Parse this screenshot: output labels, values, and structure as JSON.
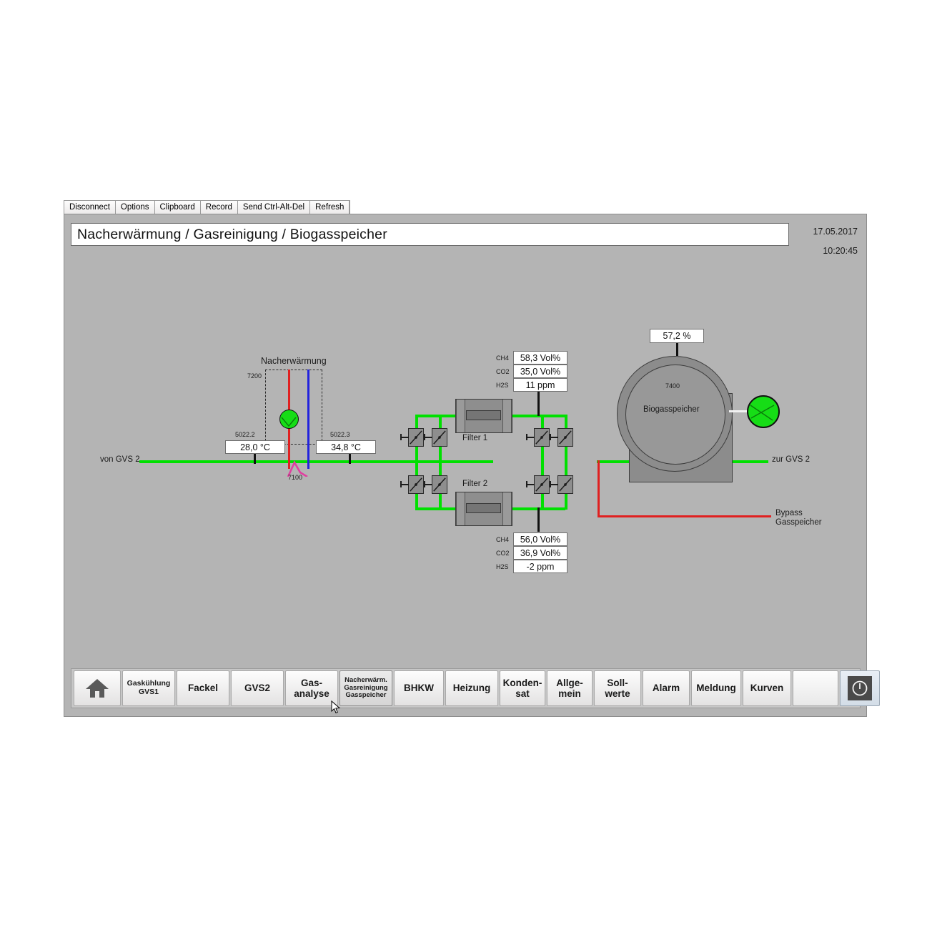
{
  "vnc_toolbar": {
    "buttons": [
      {
        "label": "Disconnect",
        "name": "disconnect"
      },
      {
        "label": "Options",
        "name": "options"
      },
      {
        "label": "Clipboard",
        "name": "clipboard"
      },
      {
        "label": "Record",
        "name": "record"
      },
      {
        "label": "Send Ctrl-Alt-Del",
        "name": "send-ctrl-alt-del"
      },
      {
        "label": "Refresh",
        "name": "refresh"
      }
    ]
  },
  "header": {
    "title": "Nacherwärmung / Gasreinigung / Biogasspeicher",
    "date": "17.05.2017",
    "time": "10:20:45"
  },
  "schematic": {
    "inlet_label": "von GVS 2",
    "outlet_label": "zur GVS 2",
    "bypass_label_line1": "Bypass",
    "bypass_label_line2": "Gasspeicher",
    "reheating": {
      "title": "Nacherwärmung",
      "tag_box": "7200",
      "tag_exchanger": "7100",
      "sensor_left_tag": "5022.2",
      "sensor_left_value": "28,0 °C",
      "sensor_right_tag": "5022.3",
      "sensor_right_value": "34,8 °C"
    },
    "filters": {
      "filter1_label": "Filter 1",
      "filter2_label": "Filter 2"
    },
    "gas_analysis_top": {
      "rows": [
        {
          "name": "CH4",
          "value": "58,3 Vol%"
        },
        {
          "name": "CO2",
          "value": "35,0 Vol%"
        },
        {
          "name": "H2S",
          "value": "11 ppm"
        }
      ]
    },
    "gas_analysis_bottom": {
      "rows": [
        {
          "name": "CH4",
          "value": "56,0 Vol%"
        },
        {
          "name": "CO2",
          "value": "36,9 Vol%"
        },
        {
          "name": "H2S",
          "value": "-2 ppm"
        }
      ]
    },
    "gas_storage": {
      "level": "57,2 %",
      "tag": "7400",
      "label": "Biogasspeicher"
    },
    "colors": {
      "pipe_gas": "#00e000",
      "pipe_bypass": "#e02020",
      "pipe_hot": "#e02020",
      "pipe_cold": "#2222dd",
      "exchanger": "#e040a0",
      "equipment_active": "#16dd16",
      "background": "#b4b4b4"
    }
  },
  "navbar": {
    "buttons": [
      {
        "name": "home",
        "label": "",
        "icon": "home-icon",
        "size": "icon"
      },
      {
        "name": "gaskuehlung-gvs1",
        "label": "Gaskühlung\nGVS1",
        "size": "small"
      },
      {
        "name": "fackel",
        "label": "Fackel",
        "size": "normal"
      },
      {
        "name": "gvs2",
        "label": "GVS2",
        "size": "normal"
      },
      {
        "name": "gasanalyse",
        "label": "Gas-\nanalyse",
        "size": "normal"
      },
      {
        "name": "nacherwaermung-gasreinigung-gasspeicher",
        "label": "Nacherwärm.\nGasreinigung\nGasspeicher",
        "size": "tiny",
        "active": true
      },
      {
        "name": "bhkw",
        "label": "BHKW",
        "size": "normal"
      },
      {
        "name": "heizung",
        "label": "Heizung",
        "size": "normal"
      },
      {
        "name": "kondensat",
        "label": "Konden-\nsat",
        "size": "normal"
      },
      {
        "name": "allgemein",
        "label": "Allge-\nmein",
        "size": "normal"
      },
      {
        "name": "sollwerte",
        "label": "Soll-\nwerte",
        "size": "normal"
      },
      {
        "name": "alarm",
        "label": "Alarm",
        "size": "normal"
      },
      {
        "name": "meldung",
        "label": "Meldung",
        "size": "normal"
      },
      {
        "name": "kurven",
        "label": "Kurven",
        "size": "normal"
      },
      {
        "name": "blank",
        "label": "",
        "size": "blank"
      },
      {
        "name": "power",
        "label": "",
        "icon": "power-icon",
        "size": "power"
      }
    ]
  }
}
